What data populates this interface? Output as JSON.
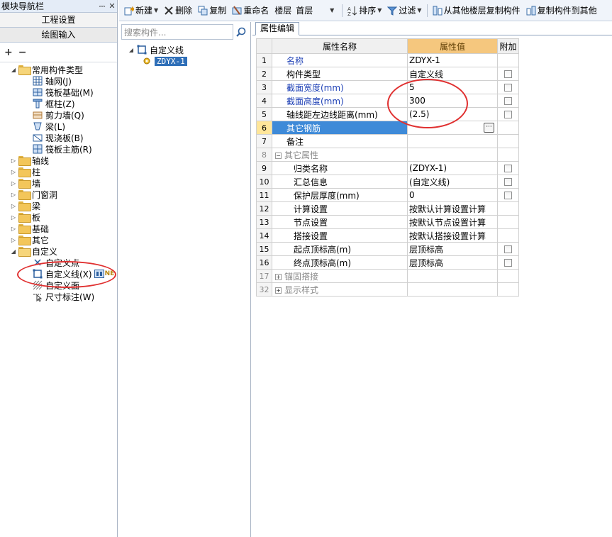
{
  "nav": {
    "title": "模块导航栏",
    "title_buttons": [
      "⎓",
      "✕"
    ],
    "project_settings_label": "工程设置",
    "drawing_input_label": "绘图输入",
    "tools": [
      "+",
      "−"
    ],
    "tree": {
      "common_types": {
        "label": "常用构件类型",
        "children": [
          {
            "label": "轴网(J)",
            "icon": "axis-grid-icon"
          },
          {
            "label": "筏板基础(M)",
            "icon": "raft-foundation-icon"
          },
          {
            "label": "框柱(Z)",
            "icon": "frame-column-icon"
          },
          {
            "label": "剪力墙(Q)",
            "icon": "shear-wall-icon"
          },
          {
            "label": "梁(L)",
            "icon": "beam-icon"
          },
          {
            "label": "现浇板(B)",
            "icon": "cast-slab-icon"
          },
          {
            "label": "筏板主筋(R)",
            "icon": "raft-rebar-icon"
          }
        ]
      },
      "groups": [
        "轴线",
        "柱",
        "墙",
        "门窗洞",
        "梁",
        "板",
        "基础",
        "其它"
      ],
      "custom": {
        "label": "自定义",
        "children": [
          {
            "label": "自定义点",
            "icon": "custom-point-icon"
          },
          {
            "label": "自定义线(X)",
            "icon": "custom-line-icon",
            "extra": "NE"
          },
          {
            "label": "自定义面",
            "icon": "custom-face-icon"
          },
          {
            "label": "尺寸标注(W)",
            "icon": "dimension-icon"
          }
        ]
      }
    }
  },
  "toolbar": {
    "new_label": "新建",
    "delete_label": "删除",
    "copy_label": "复制",
    "rename_label": "重命名",
    "floor_label": "楼层",
    "floor_value": "首层",
    "sort_label": "排序",
    "filter_label": "过滤",
    "copy_from_floor_label": "从其他楼层复制构件",
    "copy_to_floor_label": "复制构件到其他"
  },
  "component_panel": {
    "search_placeholder": "搜索构件...",
    "root_label": "自定义线",
    "selected_item": "ZDYX-1"
  },
  "property_panel": {
    "tab_label": "属性编辑",
    "headers": {
      "name": "属性名称",
      "value": "属性值",
      "extra": "附加"
    },
    "rows": [
      {
        "num": "1",
        "name": "名称",
        "value": "ZDYX-1"
      },
      {
        "num": "2",
        "name": "构件类型",
        "value": "自定义线"
      },
      {
        "num": "3",
        "name": "截面宽度(mm)",
        "value": "5"
      },
      {
        "num": "4",
        "name": "截面高度(mm)",
        "value": "300"
      },
      {
        "num": "5",
        "name": "轴线距左边线距离(mm)",
        "value": "(2.5)"
      },
      {
        "num": "6",
        "name": "其它钢筋",
        "value": "",
        "button": "···"
      },
      {
        "num": "7",
        "name": "备注",
        "value": ""
      },
      {
        "num": "8",
        "name": "其它属性",
        "value": "",
        "toggle": "−"
      },
      {
        "num": "9",
        "name": "归类名称",
        "value": "(ZDYX-1)"
      },
      {
        "num": "10",
        "name": "汇总信息",
        "value": "(自定义线)"
      },
      {
        "num": "11",
        "name": "保护层厚度(mm)",
        "value": "0"
      },
      {
        "num": "12",
        "name": "计算设置",
        "value": "按默认计算设置计算"
      },
      {
        "num": "13",
        "name": "节点设置",
        "value": "按默认节点设置计算"
      },
      {
        "num": "14",
        "name": "搭接设置",
        "value": "按默认搭接设置计算"
      },
      {
        "num": "15",
        "name": "起点顶标高(m)",
        "value": "层顶标高"
      },
      {
        "num": "16",
        "name": "终点顶标高(m)",
        "value": "层顶标高"
      },
      {
        "num": "17",
        "name": "锚固搭接",
        "value": "",
        "toggle": "+"
      },
      {
        "num": "32",
        "name": "显示样式",
        "value": "",
        "toggle": "+"
      }
    ]
  },
  "colors": {
    "highlight_blue": "#3e8ad8",
    "selected_blue": "#2f6fb8",
    "header_orange": "#f5c77e",
    "annotation_red": "#e03030",
    "name_blue": "#1c3fb5"
  }
}
